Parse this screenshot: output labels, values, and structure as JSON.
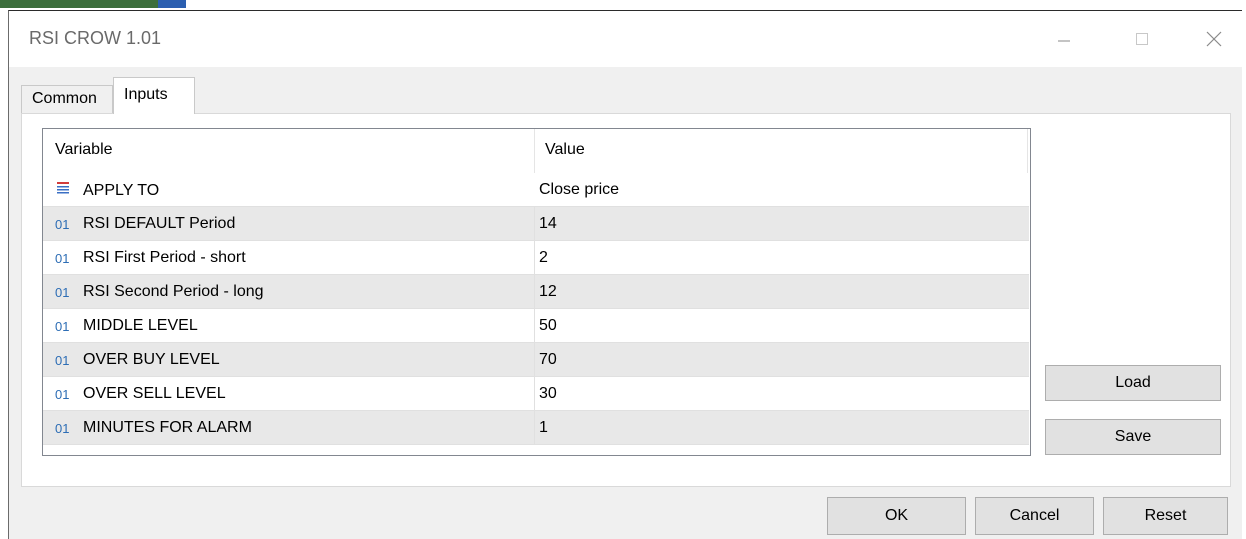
{
  "window": {
    "title": "RSI CROW 1.01"
  },
  "tabs": [
    {
      "label": "Common"
    },
    {
      "label": "Inputs"
    }
  ],
  "grid": {
    "columns": {
      "variable": "Variable",
      "value": "Value"
    },
    "rows": [
      {
        "icon": "enum-icon",
        "variable": "APPLY TO",
        "value": "Close price"
      },
      {
        "icon": "number-icon",
        "icon_text": "01",
        "variable": "RSI DEFAULT Period",
        "value": "14"
      },
      {
        "icon": "number-icon",
        "icon_text": "01",
        "variable": "RSI First Period - short",
        "value": "2"
      },
      {
        "icon": "number-icon",
        "icon_text": "01",
        "variable": "RSI Second Period - long",
        "value": "12"
      },
      {
        "icon": "number-icon",
        "icon_text": "01",
        "variable": "MIDDLE LEVEL",
        "value": "50"
      },
      {
        "icon": "number-icon",
        "icon_text": "01",
        "variable": "OVER BUY LEVEL",
        "value": "70"
      },
      {
        "icon": "number-icon",
        "icon_text": "01",
        "variable": "OVER SELL LEVEL",
        "value": "30"
      },
      {
        "icon": "number-icon",
        "icon_text": "01",
        "variable": "MINUTES FOR ALARM",
        "value": "1"
      }
    ]
  },
  "side_buttons": {
    "load": "Load",
    "save": "Save"
  },
  "footer_buttons": {
    "ok": "OK",
    "cancel": "Cancel",
    "reset": "Reset"
  },
  "colors": {
    "number_icon": "#2d6db5",
    "enum_icon_red": "#d23c3c",
    "enum_icon_blue": "#3a6fc4",
    "alt_row": "#e8e8e8"
  }
}
